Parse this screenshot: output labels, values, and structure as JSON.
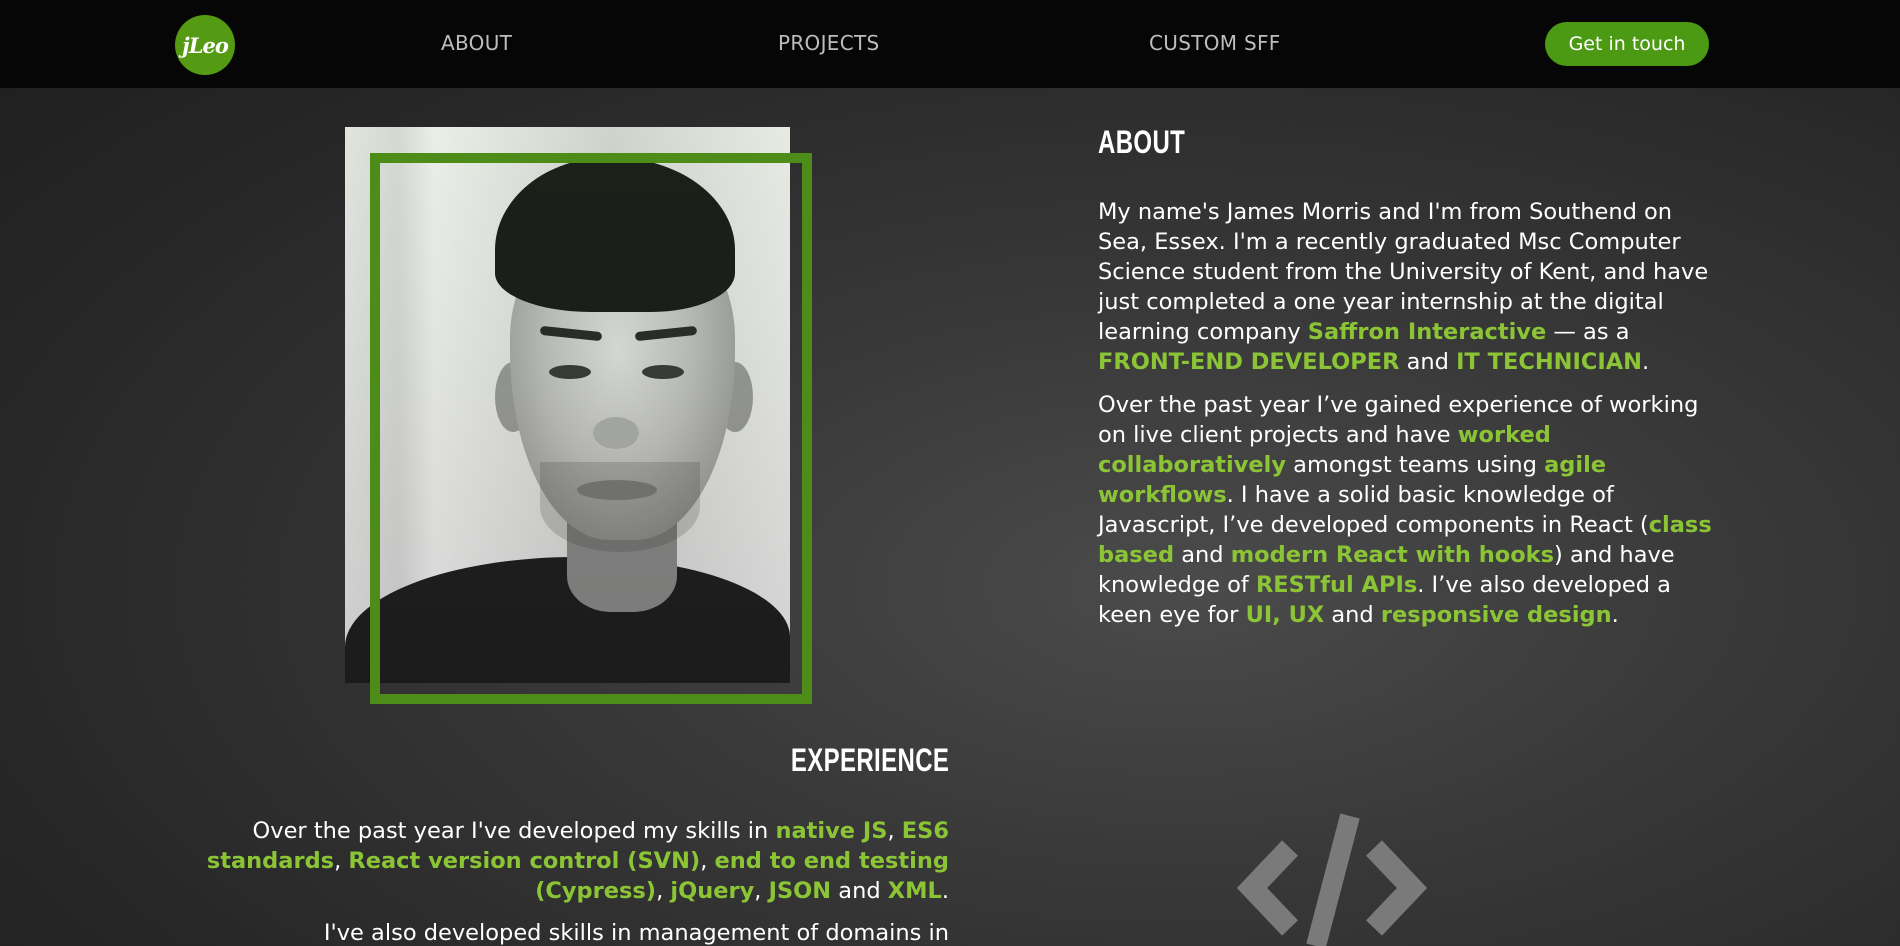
{
  "nav": {
    "logo_text": "jLeo",
    "links": [
      "ABOUT",
      "PROJECTS",
      "CUSTOM SFF"
    ],
    "cta_label": "Get in touch"
  },
  "about": {
    "heading": "ABOUT",
    "p1": {
      "a": "My name's James Morris and I'm from Southend on Sea, Essex. I'm a recently graduated Msc Computer Science student from the University of Kent, and have just completed a one year internship at the digital learning company ",
      "hl1": "Saffron Interactive",
      "b": " — as a ",
      "hl2": "FRONT-END DEVELOPER",
      "c": " and ",
      "hl3": "IT TECHNICIAN",
      "d": "."
    },
    "p2": {
      "a": "Over the past year I’ve gained experience of working on live client projects and have ",
      "hl1": "worked collaboratively",
      "b": " amongst teams using ",
      "hl2": "agile workflows",
      "c": ". I have a solid basic knowledge of Javascript, I’ve developed components in React (",
      "hl3": "class based",
      "d": " and ",
      "hl4": "modern React with hooks",
      "e": ") and have knowledge of ",
      "hl5": "RESTful APIs",
      "f": ". I’ve also developed a keen eye for ",
      "hl6": "UI, UX",
      "g": " and ",
      "hl7": "responsive design",
      "h": "."
    }
  },
  "experience": {
    "heading": "EXPERIENCE",
    "p1": {
      "a": "Over the past year I've developed my skills in ",
      "hl1": "native JS",
      "b": ", ",
      "hl2": "ES6 standards",
      "c": ", ",
      "hl3": "React version control (SVN)",
      "d": ", ",
      "hl4": "end to end testing (Cypress)",
      "e": ", ",
      "hl5": "jQuery",
      "f": ", ",
      "hl6": "JSON",
      "g": " and ",
      "hl7": "XML",
      "h": "."
    },
    "p2": "I've also developed skills in management of domains in"
  },
  "icons": {
    "logo": "jleo-logo",
    "code": "code-brackets-icon"
  },
  "colors": {
    "accent": "#8bc536",
    "brand_green": "#549a12",
    "frame_green": "#4e8c1a",
    "navbar": "#060606"
  }
}
